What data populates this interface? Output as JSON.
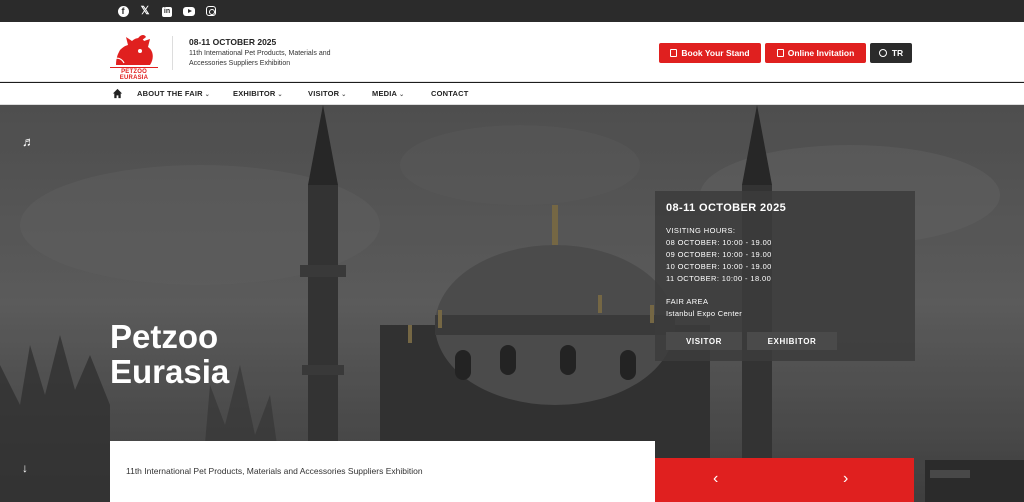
{
  "social": {
    "facebook": "f",
    "x": "𝕏",
    "linkedin": "in"
  },
  "header": {
    "logo_text": "PETZOO EURASIA",
    "event_date": "08-11 OCTOBER 2025",
    "event_description": "11th International Pet Products, Materials and Accessories Suppliers Exhibition",
    "book_stand": "Book Your Stand",
    "online_invitation": "Online Invitation",
    "language": "TR"
  },
  "nav": {
    "items": [
      {
        "label": "ABOUT THE FAIR",
        "caret": "⌄"
      },
      {
        "label": "EXHIBITOR",
        "caret": "⌄"
      },
      {
        "label": "VISITOR",
        "caret": "⌄"
      },
      {
        "label": "MEDIA",
        "caret": "⌄"
      },
      {
        "label": "CONTACT",
        "caret": ""
      }
    ]
  },
  "hero": {
    "title_line1": "Petzoo",
    "title_line2": "Eurasia",
    "music_icon": "♬",
    "scroll_down": "↓",
    "subtitle": "11th International Pet Products, Materials and Accessories Suppliers Exhibition",
    "prev_arrow": "‹",
    "next_arrow": "›"
  },
  "info": {
    "date": "08-11 OCTOBER 2025",
    "visiting_hours_label": "VISITING HOURS:",
    "hours": [
      "08 OCTOBER: 10:00 - 19.00",
      "09 OCTOBER: 10:00 - 19.00",
      "10 OCTOBER: 10:00 - 19.00",
      "11 OCTOBER: 10:00 - 18.00"
    ],
    "fair_area_label": "FAIR AREA",
    "fair_area_value": "Istanbul Expo Center",
    "visitor_btn": "VISITOR",
    "exhibitor_btn": "EXHIBITOR"
  },
  "colors": {
    "accent": "#e0201f",
    "topbar": "#2b2b2b"
  }
}
